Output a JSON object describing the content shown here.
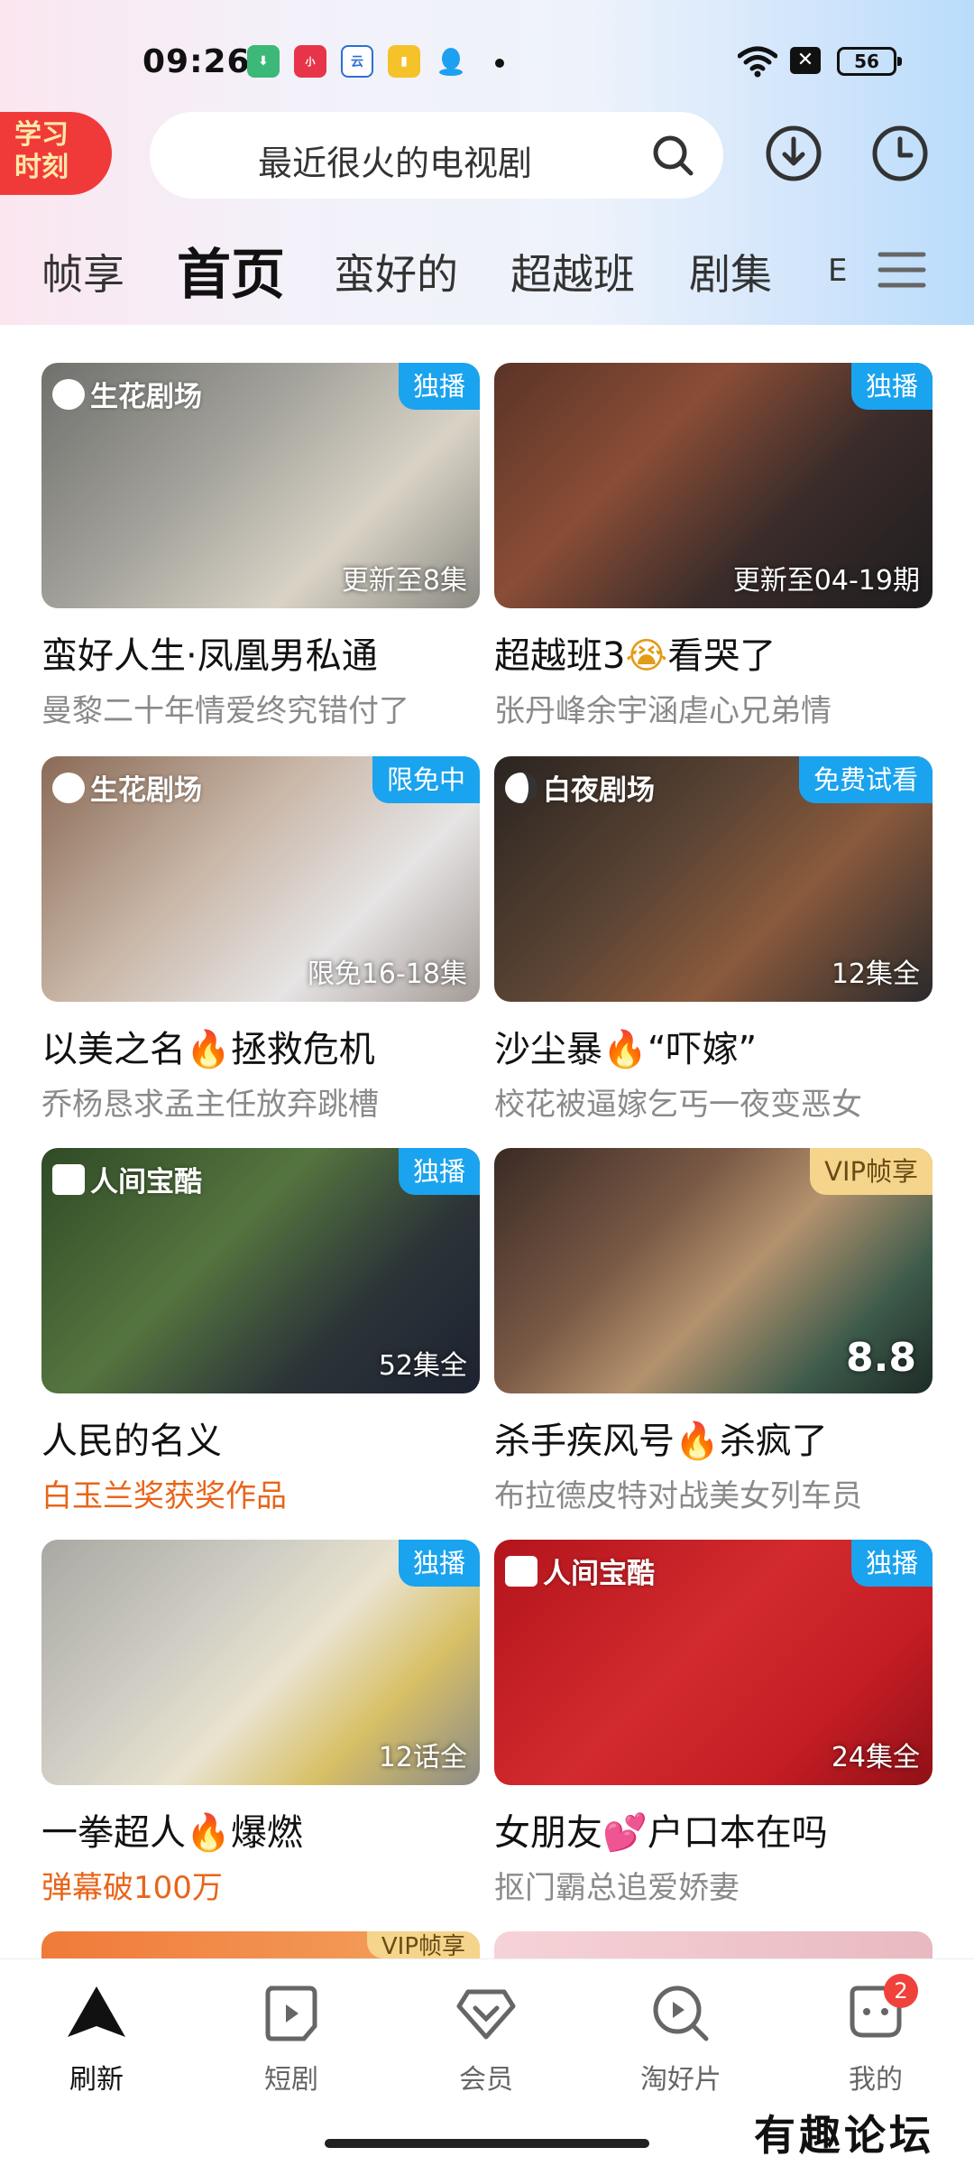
{
  "status_bar": {
    "time": "09:26",
    "battery": "56"
  },
  "header": {
    "study_badge": "学习时刻",
    "study_line1": "学习",
    "study_line2": "时刻",
    "search_placeholder": "最近很火的电视剧"
  },
  "tabs": [
    "帧享",
    "首页",
    "蛮好的",
    "超越班",
    "剧集",
    "E"
  ],
  "active_tab": "首页",
  "cards": [
    {
      "brand": "生花剧场",
      "tag": "独播",
      "overlay": "更新至8集",
      "title_a": "蛮好人生·凤凰男私通",
      "title_b": "",
      "emoji": "",
      "subtitle": "曼黎二十年情爱终究错付了"
    },
    {
      "brand": "",
      "tag": "独播",
      "overlay": "更新至04-19期",
      "title_a": "超越班3",
      "title_b": "看哭了",
      "emoji": "😭",
      "subtitle": "张丹峰余宇涵虐心兄弟情"
    },
    {
      "brand": "生花剧场",
      "tag": "限免中",
      "overlay": "限免16-18集",
      "title_a": "以美之名",
      "title_b": "拯救危机",
      "emoji": "🔥",
      "subtitle": "乔杨恳求孟主任放弃跳槽"
    },
    {
      "brand": "白夜剧场",
      "tag": "免费试看",
      "overlay": "12集全",
      "title_a": "沙尘暴",
      "title_b": "“吓嫁”",
      "emoji": "🔥",
      "subtitle": "校花被逼嫁乞丐一夜变恶女"
    },
    {
      "brand": "人间宝酷",
      "tag": "独播",
      "overlay": "52集全",
      "title_a": "人民的名义",
      "title_b": "",
      "emoji": "",
      "subtitle": "白玉兰奖获奖作品"
    },
    {
      "brand": "",
      "tag": "VIP帧享",
      "overlay": "8.8",
      "title_a": "杀手疾风号",
      "title_b": "杀疯了",
      "emoji": "🔥",
      "subtitle": "布拉德皮特对战美女列车员"
    },
    {
      "brand": "",
      "tag": "独播",
      "overlay": "12话全",
      "title_a": "一拳超人",
      "title_b": "爆燃",
      "emoji": "🔥",
      "subtitle": "弹幕破100万"
    },
    {
      "brand": "人间宝酷",
      "tag": "独播",
      "overlay": "24集全",
      "title_a": "女朋友",
      "title_b": "户口本在吗",
      "emoji": "💕",
      "subtitle": "抠门霸总追爱娇妻"
    }
  ],
  "partial_tag": "VIP帧享",
  "bottom_nav": [
    {
      "label": "刷新"
    },
    {
      "label": "短剧"
    },
    {
      "label": "会员"
    },
    {
      "label": "淘好片"
    },
    {
      "label": "我的",
      "badge": "2"
    }
  ],
  "watermark": "有趣论坛",
  "colors": {
    "accent_blue": "#1aa3ee",
    "highlight_orange": "#e8651a",
    "badge_red": "#f0413a",
    "vip_gold": "#f5d48b"
  }
}
